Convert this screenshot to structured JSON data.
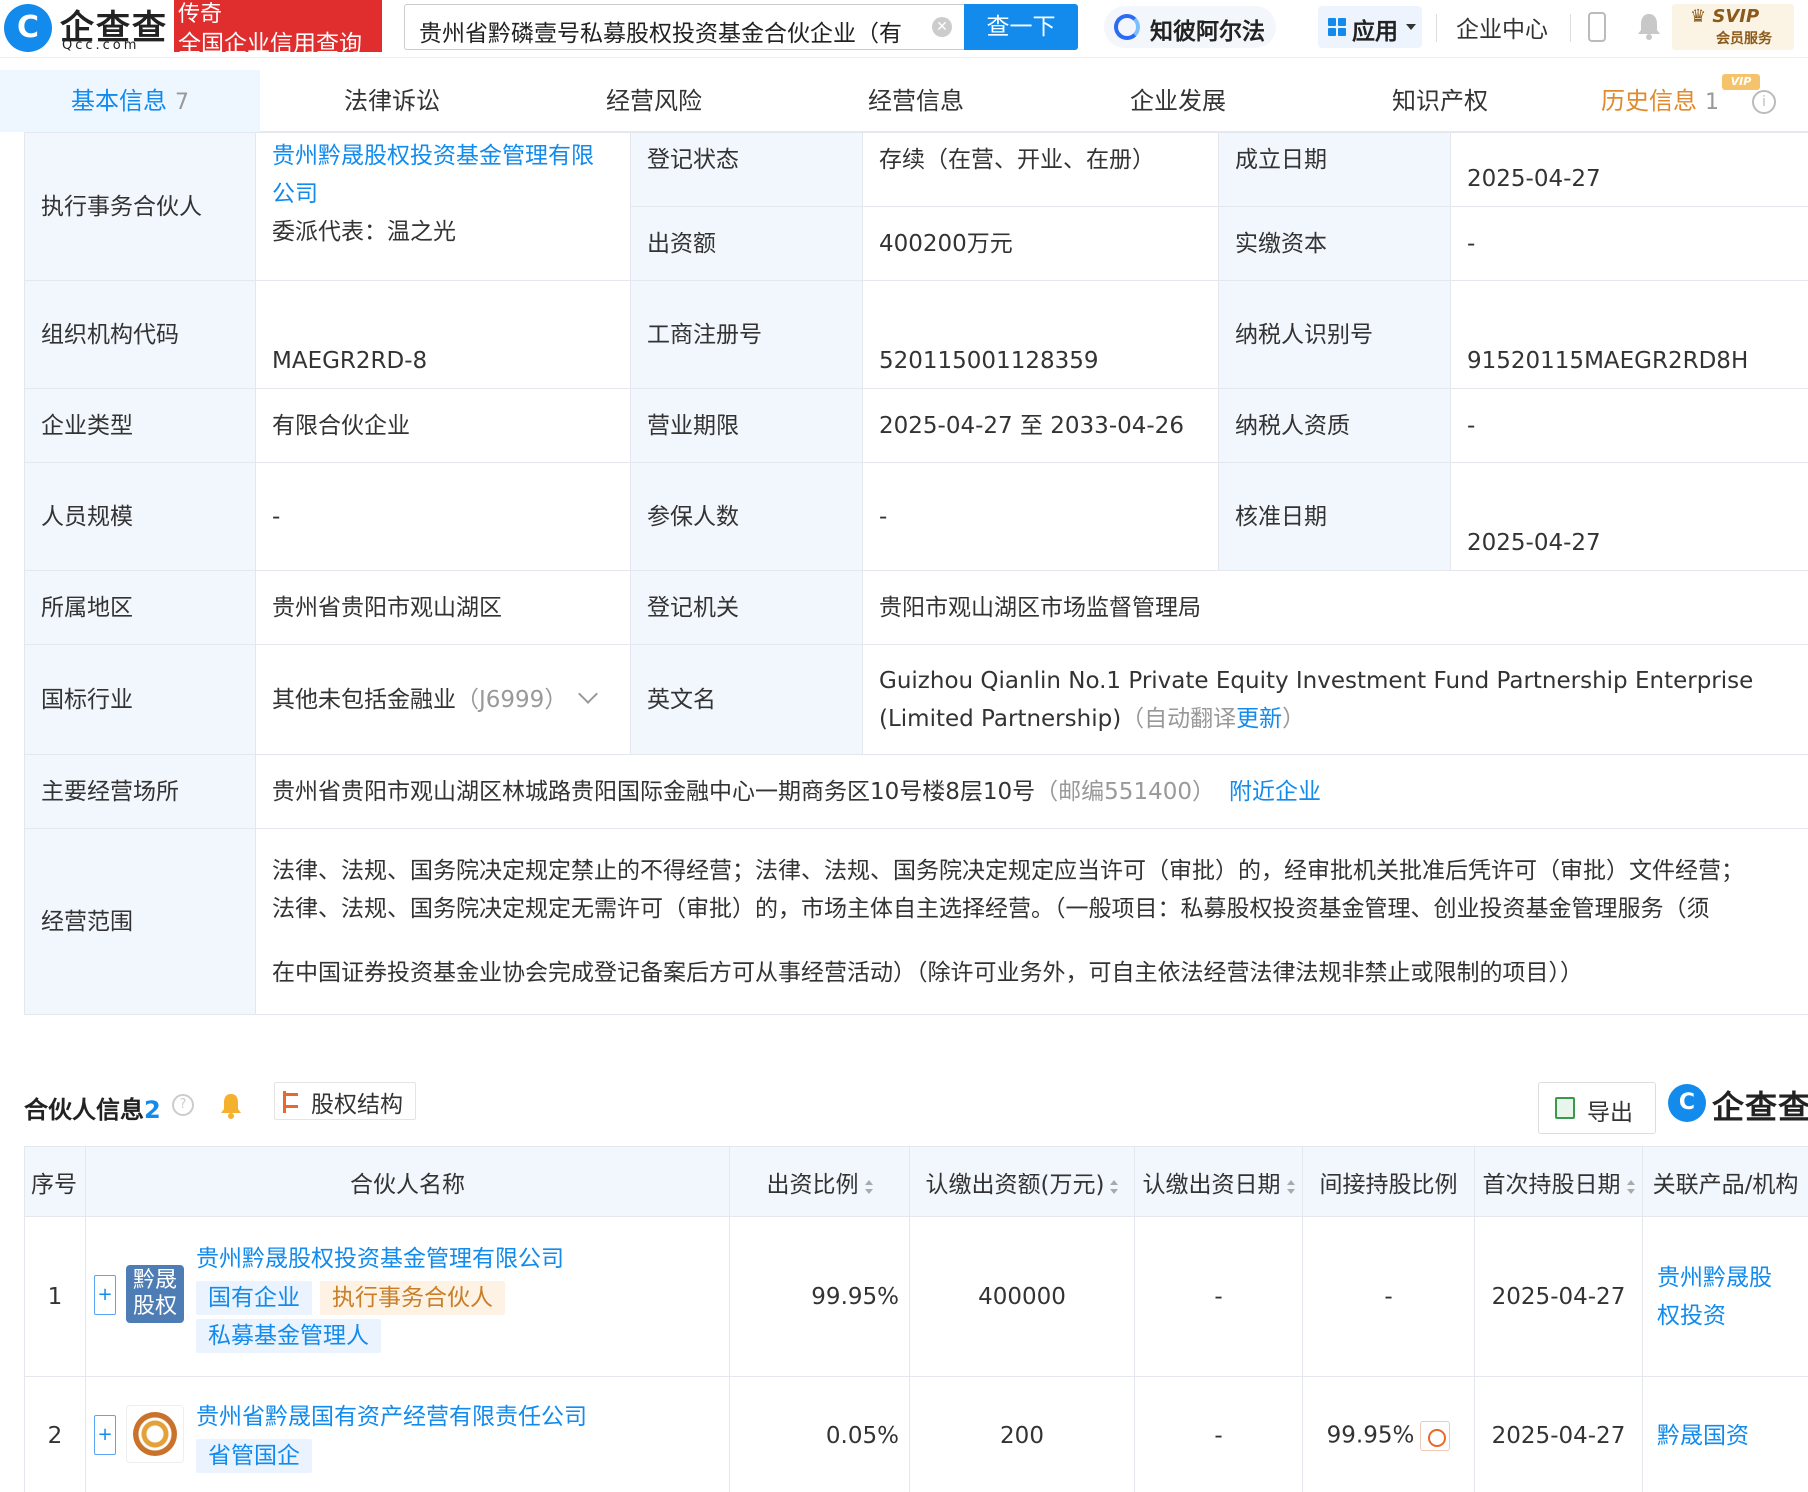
{
  "header": {
    "logo_glyph": "C",
    "logo_text": "企查查",
    "logo_sub": "Qcc.com",
    "promo_line1": "传奇",
    "promo_line2": "全国企业信用查询",
    "search_value": "贵州省黔磷壹号私募股权投资基金合伙企业（有",
    "search_button": "查一下",
    "ai_label": "知彼阿尔法",
    "app_label": "应用",
    "enterprise_center": "企业中心",
    "svip_line1": "SVIP",
    "svip_line2": "会员服务",
    "icons": [
      "search-clear-icon",
      "ai-logo-icon",
      "app-grid-icon",
      "phone-icon",
      "bell-icon",
      "vip-crown-icon"
    ]
  },
  "tabs": [
    {
      "label": "基本信息",
      "count": "7"
    },
    {
      "label": "法律诉讼"
    },
    {
      "label": "经营风险"
    },
    {
      "label": "经营信息"
    },
    {
      "label": "企业发展"
    },
    {
      "label": "知识产权"
    },
    {
      "label": "历史信息",
      "count": "1",
      "badge": "VIP"
    }
  ],
  "info": {
    "exec_partner_label": "执行事务合伙人",
    "exec_partner_name": "贵州黔晟股权投资基金管理有限公司",
    "delegate": "委派代表：温之光",
    "reg_status_label": "登记状态",
    "reg_status": "存续（在营、开业、在册）",
    "found_date_label": "成立日期",
    "found_date": "2025-04-27",
    "capital_label": "出资额",
    "capital": "400200万元",
    "paid_capital_label": "实缴资本",
    "paid_capital": "-",
    "org_code_label": "组织机构代码",
    "org_code": "MAEGR2RD-8",
    "biz_reg_no_label": "工商注册号",
    "biz_reg_no": "520115001128359",
    "tax_id_label": "纳税人识别号",
    "tax_id": "91520115MAEGR2RD8H",
    "ent_type_label": "企业类型",
    "ent_type": "有限合伙企业",
    "biz_term_label": "营业期限",
    "biz_term": "2025-04-27 至 2033-04-26",
    "tax_qual_label": "纳税人资质",
    "tax_qual": "-",
    "staff_label": "人员规模",
    "staff": "-",
    "insured_label": "参保人数",
    "insured": "-",
    "approve_date_label": "核准日期",
    "approve_date": "2025-04-27",
    "region_label": "所属地区",
    "region": "贵州省贵阳市观山湖区",
    "reg_authority_label": "登记机关",
    "reg_authority": "贵阳市观山湖区市场监督管理局",
    "industry_label": "国标行业",
    "industry": "其他未包括金融业",
    "industry_code": "（J6999）",
    "en_name_label": "英文名",
    "en_name": "Guizhou Qianlin No.1 Private Equity Investment Fund Partnership Enterprise (Limited Partnership)",
    "auto_translate": "（自动翻译",
    "update_link": "更新",
    "close_paren": "）",
    "address_label": "主要经营场所",
    "address": "贵州省贵阳市观山湖区林城路贵阳国际金融中心一期商务区10号楼8层10号",
    "postcode": "（邮编551400）",
    "nearby_link": "附近企业",
    "scope_label": "经营范围",
    "scope_line1": "法律、法规、国务院决定规定禁止的不得经营；法律、法规、国务院决定规定应当许可（审批）的，经审批机关批准后凭许可（审批）文件经营；",
    "scope_line2": "法律、法规、国务院决定规定无需许可（审批）的，市场主体自主选择经营。（一般项目：私募股权投资基金管理、创业投资基金管理服务（须",
    "scope_line3": "在中国证券投资基金业协会完成登记备案后方可从事经营活动）（除许可业务外，可自主依法经营法律法规非禁止或限制的项目））"
  },
  "partners": {
    "title": "合伙人信息",
    "count": "2",
    "equity_button": "股权结构",
    "export_button": "导出",
    "watermark": "企查查",
    "headers": [
      "序号",
      "合伙人名称",
      "出资比例",
      "认缴出资额(万元)",
      "认缴出资日期",
      "间接持股比例",
      "首次持股日期",
      "关联产品/机构"
    ],
    "rows": [
      {
        "index": "1",
        "avatar_text": "黔晟股权",
        "name": "贵州黔晟股权投资基金管理有限公司",
        "tags": [
          "国有企业",
          "执行事务合伙人",
          "私募基金管理人"
        ],
        "ratio": "99.95%",
        "amount": "400000",
        "date": "-",
        "indirect": "-",
        "first_date": "2025-04-27",
        "related": "贵州黔晟股权投资"
      },
      {
        "index": "2",
        "name": "贵州省黔晟国有资产经营有限责任公司",
        "tags": [
          "省管国企"
        ],
        "ratio": "0.05%",
        "amount": "200",
        "date": "-",
        "indirect": "99.95%",
        "first_date": "2025-04-27",
        "related": "黔晟国资"
      }
    ]
  }
}
